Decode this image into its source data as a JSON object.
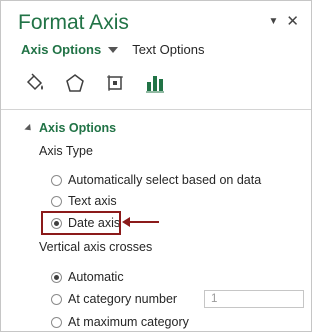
{
  "pane": {
    "title": "Format Axis",
    "menu_caret_icon": "dropdown-caret-icon",
    "close_icon": "close-icon"
  },
  "tabs": {
    "axis_options": "Axis Options",
    "text_options": "Text Options"
  },
  "icons": [
    "fill-line-icon",
    "effects-pentagon-icon",
    "size-properties-icon",
    "axis-options-bar-icon"
  ],
  "section": {
    "title": "Axis Options",
    "axis_type_label": "Axis Type",
    "axis_type_options": [
      {
        "label": "Automatically select based on data",
        "selected": false
      },
      {
        "label": "Text axis",
        "selected": false
      },
      {
        "label": "Date axis",
        "selected": true
      }
    ],
    "vertical_axis_crosses_label": "Vertical axis crosses",
    "crosses_options": [
      {
        "label": "Automatic",
        "selected": true
      },
      {
        "label": "At category number",
        "selected": false
      },
      {
        "label": "At maximum category",
        "selected": false
      }
    ],
    "category_number_value": "1"
  },
  "colors": {
    "accent": "#217346",
    "highlight_border": "#8b1a1a"
  }
}
